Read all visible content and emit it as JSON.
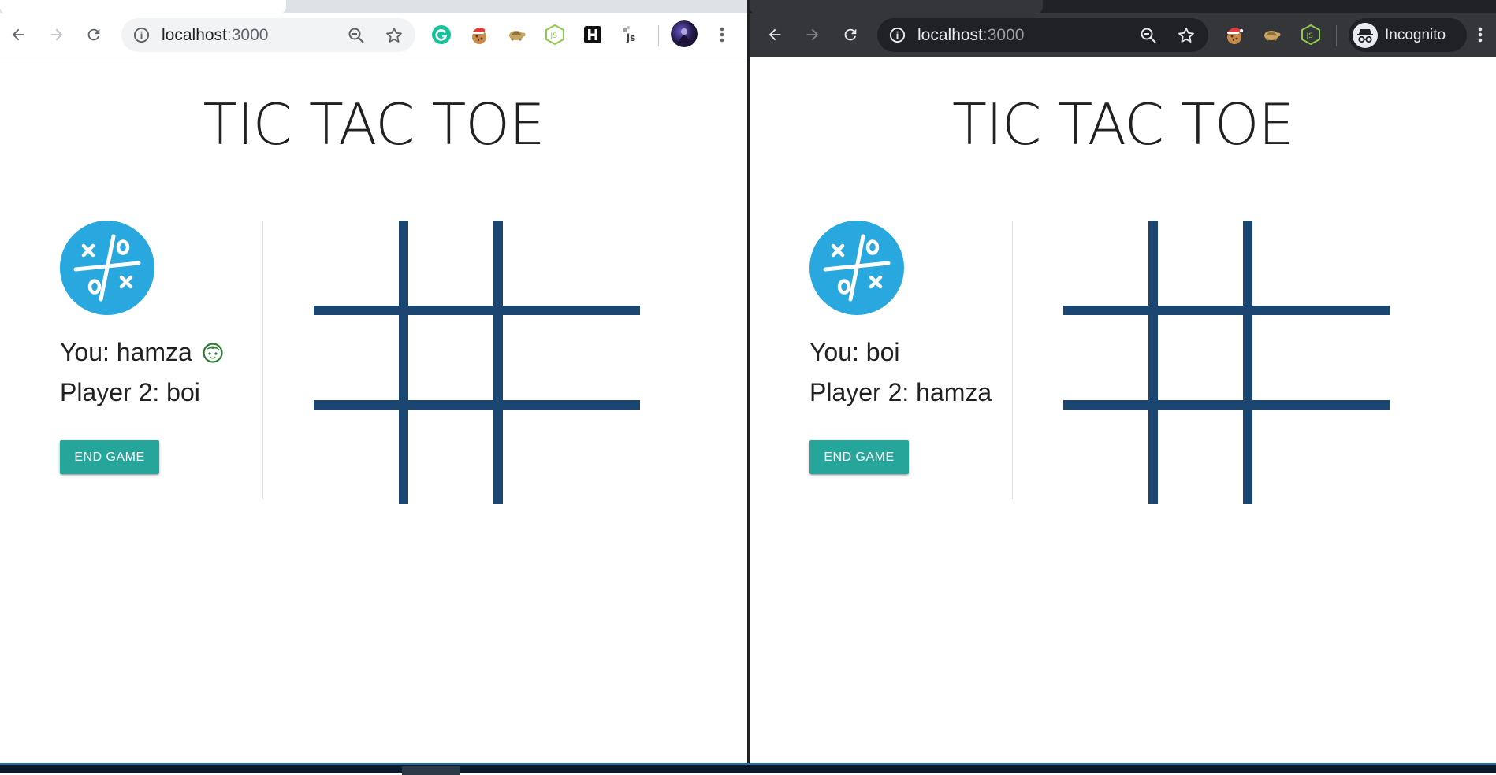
{
  "windows": [
    {
      "id": "left",
      "theme": "light",
      "url_host": "localhost",
      "url_port": ":3000",
      "extensions": [
        "grammarly-icon",
        "cookie-santa-icon",
        "tortoise-icon",
        "nodejs-icon",
        "h-icon",
        "js-tool-icon"
      ],
      "game": {
        "title": "TIC TAC TOE",
        "you_label": "You: hamza",
        "player2_label": "Player 2: boi",
        "turn_indicator": "you",
        "end_button": "END GAME"
      }
    },
    {
      "id": "right",
      "theme": "dark",
      "url_host": "localhost",
      "url_port": ":3000",
      "extensions": [
        "cookie-santa-icon",
        "tortoise-icon",
        "nodejs-icon"
      ],
      "incognito_label": "Incognito",
      "game": {
        "title": "TIC TAC TOE",
        "you_label": "You: boi",
        "player2_label": "Player 2: hamza",
        "turn_indicator": "none",
        "end_button": "END GAME"
      }
    }
  ],
  "colors": {
    "logo": "#29a8e0",
    "board_lines": "#1b4671",
    "end_button": "#26a69a",
    "turn_icon": "#2e7d32"
  },
  "board": {
    "rows": 3,
    "cols": 3,
    "cells": [
      "",
      "",
      "",
      "",
      "",
      "",
      "",
      "",
      ""
    ]
  }
}
